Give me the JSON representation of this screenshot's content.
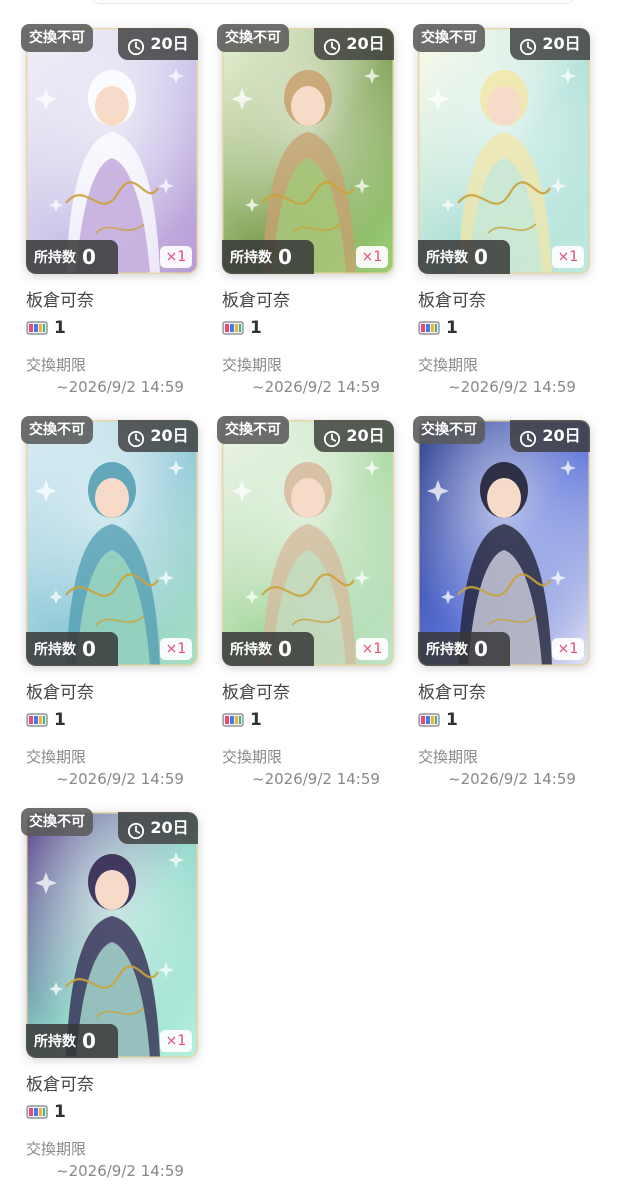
{
  "cards": [
    {
      "badge": "交換不可",
      "days": "20日",
      "owned_label": "所持数",
      "owned": "0",
      "multiplier": "×1",
      "name": "板倉可奈",
      "tickets": "1",
      "deadline_label": "交換期限",
      "deadline": "~2026/9/2 14:59",
      "palette": [
        "#f4f1f7",
        "#c9c2e8",
        "#ffffff",
        "#b89ad6"
      ]
    },
    {
      "badge": "交換不可",
      "days": "20日",
      "owned_label": "所持数",
      "owned": "0",
      "multiplier": "×1",
      "name": "板倉可奈",
      "tickets": "1",
      "deadline_label": "交換期限",
      "deadline": "~2026/9/2 14:59",
      "palette": [
        "#e7f3d6",
        "#7fa050",
        "#c9a070",
        "#9bd07a"
      ]
    },
    {
      "badge": "交換不可",
      "days": "20日",
      "owned_label": "所持数",
      "owned": "0",
      "multiplier": "×1",
      "name": "板倉可奈",
      "tickets": "1",
      "deadline_label": "交換期限",
      "deadline": "~2026/9/2 14:59",
      "palette": [
        "#fffbe8",
        "#aee0d8",
        "#f3e6a8",
        "#bfe8e0"
      ]
    },
    {
      "badge": "交換不可",
      "days": "20日",
      "owned_label": "所持数",
      "owned": "0",
      "multiplier": "×1",
      "name": "板倉可奈",
      "tickets": "1",
      "deadline_label": "交換期限",
      "deadline": "~2026/9/2 14:59",
      "palette": [
        "#d9ecf6",
        "#8cc7d6",
        "#4f9bb0",
        "#a8e0c0"
      ]
    },
    {
      "badge": "交換不可",
      "days": "20日",
      "owned_label": "所持数",
      "owned": "0",
      "multiplier": "×1",
      "name": "板倉可奈",
      "tickets": "1",
      "deadline_label": "交換期限",
      "deadline": "~2026/9/2 14:59",
      "palette": [
        "#eef4ea",
        "#a8d8a0",
        "#d7b89c",
        "#bfe3c8"
      ]
    },
    {
      "badge": "交換不可",
      "days": "20日",
      "owned_label": "所持数",
      "owned": "0",
      "multiplier": "×1",
      "name": "板倉可奈",
      "tickets": "1",
      "deadline_label": "交換期限",
      "deadline": "~2026/9/2 14:59",
      "palette": [
        "#283a8a",
        "#5a72d8",
        "#1b1b2b",
        "#e6e6f3"
      ]
    },
    {
      "badge": "交換不可",
      "days": "20日",
      "owned_label": "所持数",
      "owned": "0",
      "multiplier": "×1",
      "name": "板倉可奈",
      "tickets": "1",
      "deadline_label": "交換期限",
      "deadline": "~2026/9/2 14:59",
      "palette": [
        "#5b3a8c",
        "#8ed8c8",
        "#2b1f4a",
        "#b7f0e0"
      ]
    }
  ],
  "colors": {
    "accent": "#e84a7a",
    "badge_bg": "#5a5a5a",
    "muted_text": "#888888"
  },
  "icons": {
    "days": "clock-icon",
    "ticket": "ticket-icon"
  }
}
